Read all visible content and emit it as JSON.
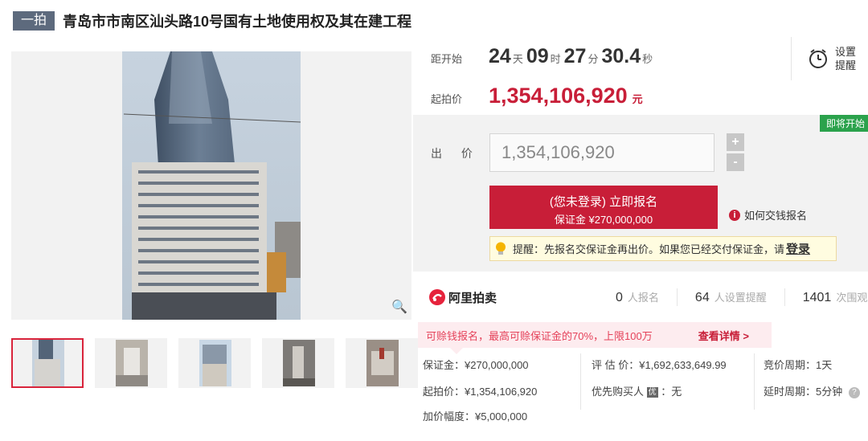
{
  "header": {
    "tag": "一拍",
    "title": "青岛市市南区汕头路10号国有土地使用权及其在建工程"
  },
  "countdown": {
    "label": "距开始",
    "days": "24",
    "days_unit": "天",
    "hours": "09",
    "hours_unit": "时",
    "minutes": "27",
    "minutes_unit": "分",
    "seconds": "30.4",
    "seconds_unit": "秒"
  },
  "reminder": {
    "line1": "设置",
    "line2": "提醒",
    "icon": "alarm-clock-icon"
  },
  "start_price": {
    "label": "起拍价",
    "value": "1,354,106,920",
    "unit": "元"
  },
  "bid_panel": {
    "status_badge": "即将开始",
    "bid_label": "出 价",
    "bid_input_value": "1,354,106,920",
    "step_up": "+",
    "step_down": "-",
    "signup_button_line1": "(您未登录) 立即报名",
    "signup_button_line2": "保证金 ¥270,000,000",
    "how_pay": "如何交钱报名",
    "hint_text": "提醒：先报名交保证金再出价。如果您已经交付保证金，请",
    "hint_login": "登录"
  },
  "stats": {
    "platform": "阿里拍卖",
    "signups": "0",
    "signups_label": "人报名",
    "reminders": "64",
    "reminders_label": "人设置提醒",
    "views": "1401",
    "views_label": "次围观"
  },
  "promo": {
    "text": "可赊钱报名，最高可赊保证金的70%，上限100万",
    "link": "查看详情 >"
  },
  "info": {
    "deposit": "保证金：¥270,000,000",
    "start_price": "起拍价：¥1,354,106,920",
    "increment": "加价幅度：¥5,000,000",
    "valuation": "评 估 价：¥1,692,633,649.99",
    "priority_label": "优先购买人",
    "priority_badge": "优",
    "priority_value": "：无",
    "cycle": "竞价周期：1天",
    "delay": "延时周期：5分钟",
    "delay_help": "?"
  },
  "colors": {
    "accent": "#c81e38",
    "green": "#2ba24c",
    "tag_bg": "#5d6a7d"
  }
}
